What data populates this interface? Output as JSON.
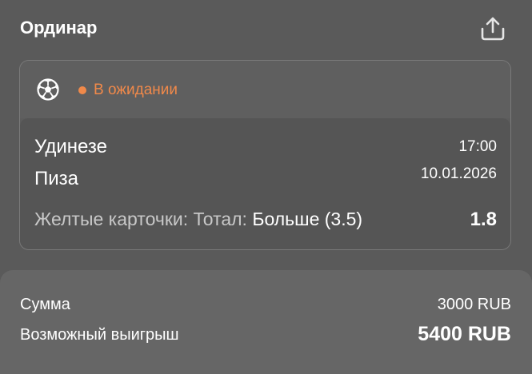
{
  "header": {
    "title": "Ординар",
    "share_icon": "share-icon"
  },
  "bet": {
    "sport_icon": "soccer-ball-icon",
    "status": "В ожидании",
    "status_color": "#f0894a",
    "team_home": "Удинезе",
    "team_away": "Пиза",
    "time": "17:00",
    "date": "10.01.2026",
    "market_name": "Желтые карточки: Тотал: ",
    "selection": "Больше (3.5)",
    "odds": "1.8"
  },
  "summary": {
    "stake_label": "Сумма",
    "stake_value": "3000 RUB",
    "win_label": "Возможный выигрыш",
    "win_value": "5400 RUB"
  }
}
